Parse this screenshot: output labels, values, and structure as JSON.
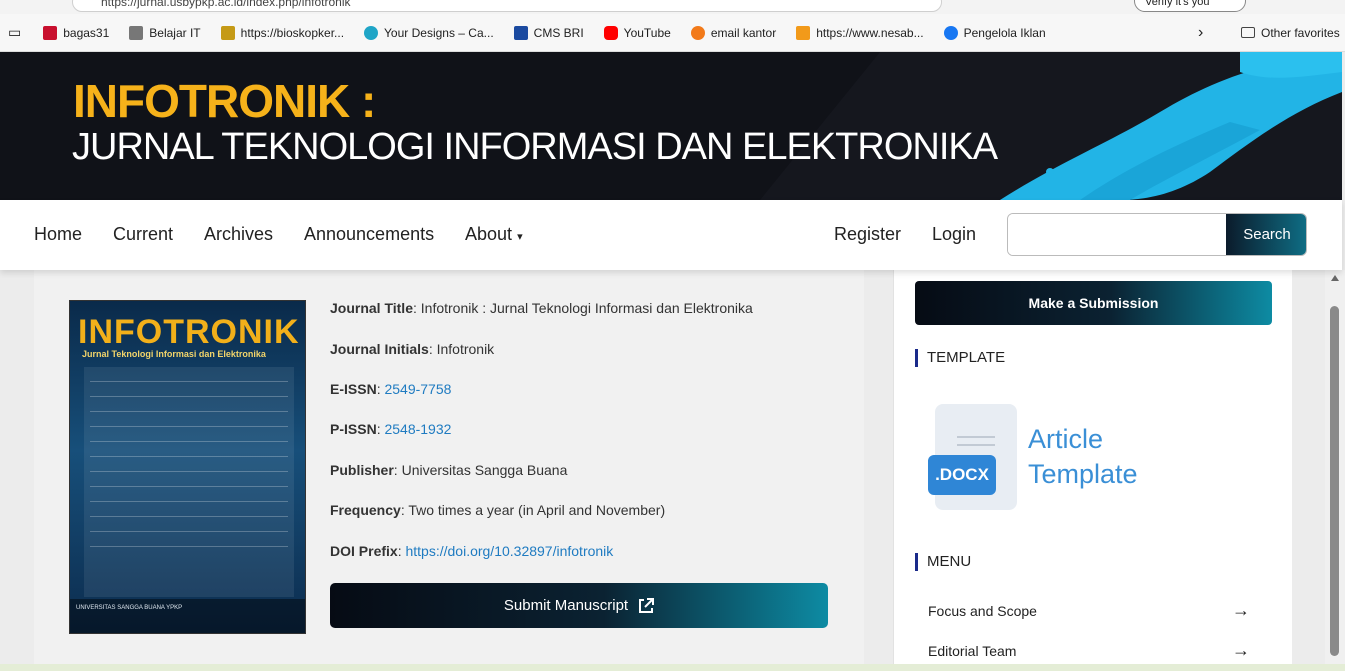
{
  "browser": {
    "url": "https://jurnal.usbypkp.ac.id/index.php/infotronik",
    "profile_label": "Verify it's you",
    "bookmarks": [
      {
        "label": "bagas31",
        "icon": "bagas31-icon",
        "color": "#c8102e"
      },
      {
        "label": "Belajar IT",
        "icon": "belajar-it-icon",
        "color": "#777777"
      },
      {
        "label": "https://bioskopker...",
        "icon": "film-icon",
        "color": "#c59a16"
      },
      {
        "label": "Your Designs – Ca...",
        "icon": "canva-icon",
        "color": "#1fa5c7"
      },
      {
        "label": "CMS BRI",
        "icon": "bri-icon",
        "color": "#1b4aa0"
      },
      {
        "label": "YouTube",
        "icon": "youtube-icon",
        "color": "#ff0000"
      },
      {
        "label": "email kantor",
        "icon": "email-icon",
        "color": "#f27a1a"
      },
      {
        "label": "https://www.nesab...",
        "icon": "nesab-icon",
        "color": "#f29a1a"
      },
      {
        "label": "Pengelola Iklan",
        "icon": "facebook-icon",
        "color": "#1877f2"
      }
    ],
    "other_favorites": "Other favorites"
  },
  "banner": {
    "title": "INFOTRONIK :",
    "subtitle": "JURNAL TEKNOLOGI INFORMASI DAN ELEKTRONIKA"
  },
  "nav": {
    "home": "Home",
    "current": "Current",
    "archives": "Archives",
    "announcements": "Announcements",
    "about": "About",
    "register": "Register",
    "login": "Login",
    "search_placeholder": "",
    "search_button": "Search"
  },
  "cover": {
    "title": "INFOTRONIK",
    "subtitle": "Jurnal Teknologi Informasi dan Elektronika",
    "publisher": "UNIVERSITAS SANGGA BUANA YPKP"
  },
  "journal": {
    "title_label": "Journal Title",
    "title_value": "Infotronik : Jurnal Teknologi Informasi dan Elektronika",
    "initials_label": "Journal Initials",
    "initials_value": "Infotronik",
    "eissn_label": "E-ISSN",
    "eissn_value": "2549-7758",
    "pissn_label": "P-ISSN",
    "pissn_value": "2548-1932",
    "publisher_label": "Publisher",
    "publisher_value": "Universitas Sangga Buana",
    "frequency_label": "Frequency",
    "frequency_value": "Two times a year (in April and November)",
    "doi_label": "DOI Prefix",
    "doi_value": "https://doi.org/10.32897/infotronik",
    "submit_manuscript": "Submit Manuscript"
  },
  "sidebar": {
    "make_submission": "Make a Submission",
    "template_title": "TEMPLATE",
    "docx_badge": ".DOCX",
    "template_line1": "Article",
    "template_line2": "Template",
    "menu_title": "MENU",
    "menu_items": [
      "Focus and Scope",
      "Editorial Team"
    ]
  }
}
